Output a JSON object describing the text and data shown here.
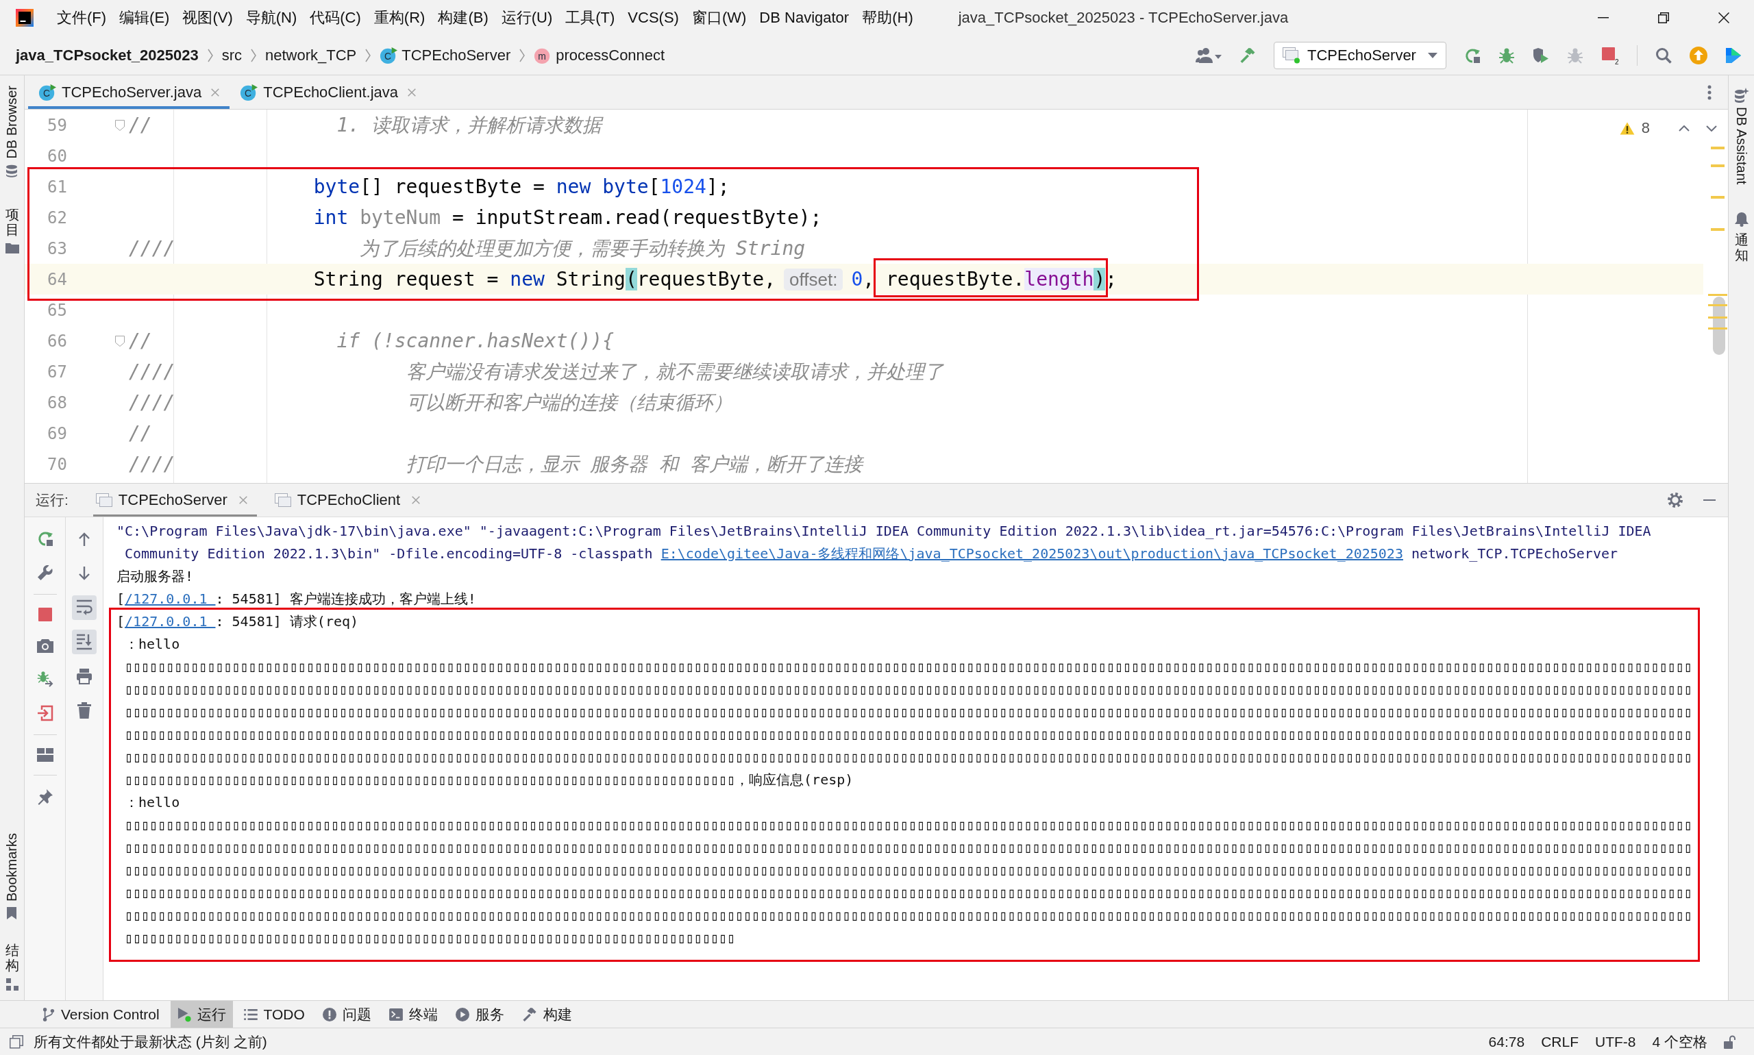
{
  "title_bar": {
    "menu": [
      "文件(F)",
      "编辑(E)",
      "视图(V)",
      "导航(N)",
      "代码(C)",
      "重构(R)",
      "构建(B)",
      "运行(U)",
      "工具(T)",
      "VCS(S)",
      "窗口(W)",
      "DB Navigator",
      "帮助(H)"
    ],
    "title": "java_TCPsocket_2025023 - TCPEchoServer.java"
  },
  "nav_bar": {
    "breadcrumbs": [
      {
        "label": "java_TCPsocket_2025023",
        "kind": "project"
      },
      {
        "label": "src",
        "kind": "folder"
      },
      {
        "label": "network_TCP",
        "kind": "package"
      },
      {
        "label": "TCPEchoServer",
        "kind": "class",
        "badge": "C"
      },
      {
        "label": "processConnect",
        "kind": "method",
        "badge": "m"
      }
    ],
    "run_config": "TCPEchoServer",
    "stop_count": "2"
  },
  "left_strip": {
    "top": [
      {
        "label": "DB Browser",
        "kind": "database"
      },
      {
        "label": "项目",
        "kind": "folder"
      }
    ],
    "bottom": [
      {
        "label": "Bookmarks",
        "kind": "bookmark"
      },
      {
        "label": "结构",
        "kind": "structure"
      }
    ]
  },
  "right_strip": [
    {
      "label": "DB Assistant",
      "kind": "assistant"
    },
    {
      "label": "通知",
      "kind": "bell"
    }
  ],
  "editor_tabs": [
    {
      "label": "TCPEchoServer.java",
      "badge": "C",
      "selected": true
    },
    {
      "label": "TCPEchoClient.java",
      "badge": "C",
      "selected": false
    }
  ],
  "editor": {
    "warning_count": "8",
    "lines": [
      {
        "number": "59",
        "current": false,
        "fold": true,
        "tokens": [
          {
            "text": "//                1. 读取请求，并解析请求数据",
            "kind": "comment"
          }
        ]
      },
      {
        "number": "60",
        "current": false,
        "fold": false
      },
      {
        "number": "61",
        "current": false,
        "fold": false,
        "tokens": [
          {
            "text": "                byte",
            "kind": "keyword"
          },
          {
            "text": "[] requestByte = ",
            "kind": "plain"
          },
          {
            "text": "new byte",
            "kind": "keyword"
          },
          {
            "text": "[",
            "kind": "plain"
          },
          {
            "text": "1024",
            "kind": "number"
          },
          {
            "text": "];",
            "kind": "plain"
          }
        ]
      },
      {
        "number": "62",
        "current": false,
        "fold": false,
        "tokens": [
          {
            "text": "                int",
            "kind": "keyword"
          },
          {
            "text": " byteNum",
            "kind": "unused"
          },
          {
            "text": " = inputStream.read(requestByte);",
            "kind": "plain"
          }
        ]
      },
      {
        "number": "63",
        "current": false,
        "fold": false,
        "tokens": [
          {
            "text": "////                为了后续的处理更加方便，需要手动转换为 String",
            "kind": "comment"
          }
        ]
      },
      {
        "number": "64",
        "current": true,
        "fold": false,
        "tokens": [
          {
            "text": "                String request = ",
            "kind": "plain"
          },
          {
            "text": "new",
            "kind": "keyword"
          },
          {
            "text": " String",
            "kind": "plain"
          },
          {
            "text": "(",
            "kind": "brace_match"
          },
          {
            "text": "requestByte,",
            "kind": "plain"
          },
          {
            "text": "offset:",
            "kind": "hint"
          },
          {
            "text": "0",
            "kind": "number"
          },
          {
            "text": ", requestByte.",
            "kind": "plain"
          },
          {
            "text": "length",
            "kind": "field_usage"
          },
          {
            "text": ")",
            "kind": "brace_match"
          },
          {
            "text": ";",
            "kind": "plain"
          }
        ]
      },
      {
        "number": "65",
        "current": false,
        "fold": false
      },
      {
        "number": "66",
        "current": false,
        "fold": true,
        "tokens": [
          {
            "text": "//                if (!scanner.hasNext()){",
            "kind": "comment"
          }
        ]
      },
      {
        "number": "67",
        "current": false,
        "fold": false,
        "tokens": [
          {
            "text": "////                    客户端没有请求发送过来了，就不需要继续读取请求，并处理了",
            "kind": "comment"
          }
        ]
      },
      {
        "number": "68",
        "current": false,
        "fold": false,
        "tokens": [
          {
            "text": "////                    可以断开和客户端的连接（结束循环）",
            "kind": "comment"
          }
        ]
      },
      {
        "number": "69",
        "current": false,
        "fold": false,
        "tokens": [
          {
            "text": "//",
            "kind": "comment"
          }
        ]
      },
      {
        "number": "70",
        "current": false,
        "fold": false,
        "tokens": [
          {
            "text": "////                    打印一个日志，显示 服务器 和 客户端，断开了连接",
            "kind": "comment"
          }
        ]
      }
    ]
  },
  "run_panel": {
    "label": "运行:",
    "tabs": [
      {
        "label": "TCPEchoServer",
        "selected": true
      },
      {
        "label": "TCPEchoClient",
        "selected": false
      }
    ],
    "left_tools": [
      [
        {
          "kind": "rerun"
        },
        {
          "kind": "wrench"
        }
      ],
      [
        {
          "kind": "stop"
        },
        {
          "kind": "camera"
        },
        {
          "kind": "debug"
        },
        {
          "kind": "exit"
        }
      ],
      [
        {
          "kind": "layout"
        }
      ],
      [
        {
          "kind": "pin"
        }
      ]
    ],
    "right_tools": [
      {
        "kind": "up",
        "on": false
      },
      {
        "kind": "down",
        "on": false
      },
      {
        "kind": "soft_wrap",
        "on": true
      },
      {
        "kind": "scroll_end",
        "on": true
      },
      {
        "kind": "print",
        "on": false
      },
      {
        "kind": "trash",
        "on": false
      }
    ],
    "console": [
      {
        "lines": [
          [
            {
              "text": "\"C:\\Program Files\\Java\\jdk-17\\bin\\java.exe\" \"-javaagent:C:\\Program Files\\JetBrains\\IntelliJ IDEA Community Edition 2022.1.3\\lib\\idea_rt.jar=54576:C:\\Program Files\\JetBrains\\IntelliJ IDEA",
              "kind": "system"
            }
          ],
          [
            {
              "text": "Community Edition 2022.1.3\\bin\" -Dfile.encoding=UTF-8 -classpath ",
              "kind": "system"
            },
            {
              "text": "E:\\code\\gitee\\Java-多线程和网络\\java_TCPsocket_2025023\\out\\production\\java_TCPsocket_2025023",
              "kind": "link"
            },
            {
              "text": " network_TCP.TCPEchoServer",
              "kind": "system"
            }
          ]
        ]
      },
      {
        "lines": [
          [
            {
              "text": "启动服务器!",
              "kind": "output"
            }
          ]
        ]
      },
      {
        "lines": [
          [
            {
              "text": "[",
              "kind": "output"
            },
            {
              "text": "/127.0.0.1 ",
              "kind": "link"
            },
            {
              "text": ": 54581] 客户端连接成功，客户端上线!",
              "kind": "output"
            }
          ]
        ]
      },
      {
        "lines": [
          [
            {
              "text": "[",
              "kind": "output"
            },
            {
              "text": "/127.0.0.1 ",
              "kind": "link"
            },
            {
              "text": ": 54581] 请求(req)",
              "kind": "output"
            }
          ],
          [
            {
              "text": "：hello",
              "kind": "output"
            }
          ],
          [
            {
              "text": "▯▯▯▯▯▯▯▯▯▯▯▯▯▯▯▯▯▯▯▯▯▯▯▯▯▯▯▯▯▯▯▯▯▯▯▯▯▯▯▯▯▯▯▯▯▯▯▯▯▯▯▯▯▯▯▯▯▯▯▯▯▯▯▯",
              "kind": "output"
            },
            {
              "text": "▯▯▯▯▯▯▯▯▯▯▯▯▯▯▯▯▯▯▯▯▯▯▯▯▯▯▯▯▯▯▯▯▯▯▯▯▯▯▯▯▯▯▯▯▯▯▯▯▯▯▯▯▯▯▯▯▯▯▯▯▯▯▯▯",
              "kind": "output"
            },
            {
              "text": "▯▯▯▯▯▯▯▯▯▯▯▯▯▯▯▯▯▯▯▯▯▯▯▯▯▯▯▯▯▯▯▯▯▯▯▯▯▯▯▯▯▯▯▯▯▯▯▯▯▯▯▯▯▯▯▯▯▯▯▯▯▯▯▯",
              "kind": "output"
            },
            {
              "text": "▯▯▯▯▯▯▯▯▯▯▯▯▯▯▯▯▯▯▯▯▯▯▯▯▯▯▯▯▯▯▯▯▯▯▯▯▯▯▯▯▯▯▯▯▯▯▯▯▯▯▯▯▯▯▯▯▯▯▯▯▯▯▯▯",
              "kind": "output"
            },
            {
              "text": "▯▯▯▯▯▯▯▯▯▯▯▯▯▯▯▯▯▯▯▯▯▯▯▯▯▯▯▯▯▯▯▯▯▯▯▯▯▯▯▯▯▯▯▯▯▯▯▯▯▯▯▯▯▯▯▯▯▯▯▯▯▯▯▯",
              "kind": "output"
            },
            {
              "text": "▯▯▯▯▯▯▯▯▯▯▯▯▯▯▯▯▯▯▯▯▯▯▯▯▯▯▯▯▯▯▯▯▯▯▯▯▯▯▯▯▯▯▯▯▯▯▯▯▯▯▯▯▯▯▯▯▯▯▯▯▯▯▯▯",
              "kind": "output"
            },
            {
              "text": "▯▯▯▯▯▯▯▯▯▯▯▯▯▯▯▯▯▯▯▯▯▯▯▯▯▯▯▯▯▯▯▯▯▯▯▯▯▯▯▯▯▯▯▯▯▯▯▯▯▯▯▯▯▯▯▯▯▯▯▯▯▯▯▯",
              "kind": "output"
            },
            {
              "text": "▯▯▯▯▯▯▯▯▯▯▯▯▯▯▯▯▯▯▯▯▯▯▯▯▯▯▯▯▯▯▯▯▯▯▯▯▯▯▯▯▯▯▯▯▯▯▯▯▯▯▯▯▯▯▯▯▯▯▯▯▯▯▯▯",
              "kind": "output"
            },
            {
              "text": "▯▯▯▯▯▯▯▯▯▯▯▯▯▯▯▯▯▯▯▯▯▯▯▯▯▯▯▯▯▯▯▯▯▯▯▯▯▯▯▯▯▯▯▯▯▯▯▯▯▯▯▯▯▯▯▯▯▯▯▯▯▯▯▯",
              "kind": "output"
            },
            {
              "text": "▯▯▯▯▯▯▯▯▯▯▯▯▯▯▯▯▯▯▯▯▯▯▯▯▯▯▯▯▯▯▯▯▯▯▯▯▯▯▯▯▯▯▯▯▯▯▯▯▯▯▯▯▯▯▯▯▯▯▯▯▯▯▯▯",
              "kind": "output"
            },
            {
              "text": "▯▯▯▯▯▯▯▯▯▯▯▯▯▯▯▯▯▯▯▯▯▯▯▯▯▯▯▯▯▯▯▯▯▯▯▯▯▯▯▯▯▯▯▯▯▯▯▯▯▯▯▯▯▯▯▯▯▯▯▯▯▯▯▯",
              "kind": "output"
            },
            {
              "text": "▯▯▯▯▯▯▯▯▯▯▯▯▯▯▯▯▯▯▯▯▯▯▯▯▯▯▯▯▯▯▯▯▯▯▯▯▯▯▯▯▯▯▯▯▯▯▯▯▯▯▯▯▯▯▯▯▯▯▯▯▯▯▯▯",
              "kind": "output"
            },
            {
              "text": "▯▯▯▯▯▯▯▯▯▯▯▯▯▯▯▯▯▯▯▯▯▯▯▯▯▯▯▯▯▯▯▯▯▯▯▯▯▯▯▯▯▯▯▯▯▯▯▯▯▯▯▯▯▯▯▯▯▯▯▯▯▯▯▯",
              "kind": "output"
            },
            {
              "text": "▯▯▯▯▯▯▯▯▯▯▯▯▯▯▯▯▯▯▯▯▯▯▯▯▯▯▯▯▯▯▯▯▯▯▯▯▯▯▯▯▯▯▯▯▯▯▯▯▯▯▯▯▯▯▯▯▯▯▯▯▯▯▯▯",
              "kind": "output"
            },
            {
              "text": "▯▯▯▯▯▯▯▯▯▯▯▯▯▯▯▯▯▯▯▯▯▯▯▯▯▯▯▯▯▯▯▯▯▯▯▯▯▯▯▯▯▯▯▯▯▯▯▯▯▯▯▯▯▯▯▯▯▯▯▯▯▯▯▯",
              "kind": "output"
            },
            {
              "text": "▯▯▯▯▯▯▯▯▯▯▯▯▯▯▯▯▯▯▯▯▯▯▯▯▯▯▯▯▯▯▯▯▯▯▯▯▯▯▯▯▯▯▯▯▯▯▯▯▯▯▯▯▯▯▯▯▯▯▯▯▯▯▯▯，响应信息(resp)",
              "kind": "output"
            }
          ],
          [
            {
              "text": "：hello",
              "kind": "output"
            }
          ],
          [
            {
              "text": "▯▯▯▯▯▯▯▯▯▯▯▯▯▯▯▯▯▯▯▯▯▯▯▯▯▯▯▯▯▯▯▯▯▯▯▯▯▯▯▯▯▯▯▯▯▯▯▯▯▯▯▯▯▯▯▯▯▯▯▯▯▯▯▯",
              "kind": "output"
            },
            {
              "text": "▯▯▯▯▯▯▯▯▯▯▯▯▯▯▯▯▯▯▯▯▯▯▯▯▯▯▯▯▯▯▯▯▯▯▯▯▯▯▯▯▯▯▯▯▯▯▯▯▯▯▯▯▯▯▯▯▯▯▯▯▯▯▯▯",
              "kind": "output"
            },
            {
              "text": "▯▯▯▯▯▯▯▯▯▯▯▯▯▯▯▯▯▯▯▯▯▯▯▯▯▯▯▯▯▯▯▯▯▯▯▯▯▯▯▯▯▯▯▯▯▯▯▯▯▯▯▯▯▯▯▯▯▯▯▯▯▯▯▯",
              "kind": "output"
            },
            {
              "text": "▯▯▯▯▯▯▯▯▯▯▯▯▯▯▯▯▯▯▯▯▯▯▯▯▯▯▯▯▯▯▯▯▯▯▯▯▯▯▯▯▯▯▯▯▯▯▯▯▯▯▯▯▯▯▯▯▯▯▯▯▯▯▯▯",
              "kind": "output"
            },
            {
              "text": "▯▯▯▯▯▯▯▯▯▯▯▯▯▯▯▯▯▯▯▯▯▯▯▯▯▯▯▯▯▯▯▯▯▯▯▯▯▯▯▯▯▯▯▯▯▯▯▯▯▯▯▯▯▯▯▯▯▯▯▯▯▯▯▯",
              "kind": "output"
            },
            {
              "text": "▯▯▯▯▯▯▯▯▯▯▯▯▯▯▯▯▯▯▯▯▯▯▯▯▯▯▯▯▯▯▯▯▯▯▯▯▯▯▯▯▯▯▯▯▯▯▯▯▯▯▯▯▯▯▯▯▯▯▯▯▯▯▯▯",
              "kind": "output"
            },
            {
              "text": "▯▯▯▯▯▯▯▯▯▯▯▯▯▯▯▯▯▯▯▯▯▯▯▯▯▯▯▯▯▯▯▯▯▯▯▯▯▯▯▯▯▯▯▯▯▯▯▯▯▯▯▯▯▯▯▯▯▯▯▯▯▯▯▯",
              "kind": "output"
            },
            {
              "text": "▯▯▯▯▯▯▯▯▯▯▯▯▯▯▯▯▯▯▯▯▯▯▯▯▯▯▯▯▯▯▯▯▯▯▯▯▯▯▯▯▯▯▯▯▯▯▯▯▯▯▯▯▯▯▯▯▯▯▯▯▯▯▯▯",
              "kind": "output"
            },
            {
              "text": "▯▯▯▯▯▯▯▯▯▯▯▯▯▯▯▯▯▯▯▯▯▯▯▯▯▯▯▯▯▯▯▯▯▯▯▯▯▯▯▯▯▯▯▯▯▯▯▯▯▯▯▯▯▯▯▯▯▯▯▯▯▯▯▯",
              "kind": "output"
            },
            {
              "text": "▯▯▯▯▯▯▯▯▯▯▯▯▯▯▯▯▯▯▯▯▯▯▯▯▯▯▯▯▯▯▯▯▯▯▯▯▯▯▯▯▯▯▯▯▯▯▯▯▯▯▯▯▯▯▯▯▯▯▯▯▯▯▯▯",
              "kind": "output"
            },
            {
              "text": "▯▯▯▯▯▯▯▯▯▯▯▯▯▯▯▯▯▯▯▯▯▯▯▯▯▯▯▯▯▯▯▯▯▯▯▯▯▯▯▯▯▯▯▯▯▯▯▯▯▯▯▯▯▯▯▯▯▯▯▯▯▯▯▯",
              "kind": "output"
            },
            {
              "text": "▯▯▯▯▯▯▯▯▯▯▯▯▯▯▯▯▯▯▯▯▯▯▯▯▯▯▯▯▯▯▯▯▯▯▯▯▯▯▯▯▯▯▯▯▯▯▯▯▯▯▯▯▯▯▯▯▯▯▯▯▯▯▯▯",
              "kind": "output"
            },
            {
              "text": "▯▯▯▯▯▯▯▯▯▯▯▯▯▯▯▯▯▯▯▯▯▯▯▯▯▯▯▯▯▯▯▯▯▯▯▯▯▯▯▯▯▯▯▯▯▯▯▯▯▯▯▯▯▯▯▯▯▯▯▯▯▯▯▯",
              "kind": "output"
            },
            {
              "text": "▯▯▯▯▯▯▯▯▯▯▯▯▯▯▯▯▯▯▯▯▯▯▯▯▯▯▯▯▯▯▯▯▯▯▯▯▯▯▯▯▯▯▯▯▯▯▯▯▯▯▯▯▯▯▯▯▯▯▯▯▯▯▯▯",
              "kind": "output"
            },
            {
              "text": "▯▯▯▯▯▯▯▯▯▯▯▯▯▯▯▯▯▯▯▯▯▯▯▯▯▯▯▯▯▯▯▯▯▯▯▯▯▯▯▯▯▯▯▯▯▯▯▯▯▯▯▯▯▯▯▯▯▯▯▯▯▯▯▯",
              "kind": "output"
            },
            {
              "text": "▯▯▯▯▯▯▯▯▯▯▯▯▯▯▯▯▯▯▯▯▯▯▯▯▯▯▯▯▯▯▯▯▯▯▯▯▯▯▯▯▯▯▯▯▯▯▯▯▯▯▯▯▯▯▯▯▯▯▯▯▯▯▯▯",
              "kind": "output"
            }
          ]
        ]
      }
    ]
  },
  "tool_window_bar": [
    {
      "label": "Version Control",
      "kind": "vcs",
      "selected": false
    },
    {
      "label": "运行",
      "kind": "run",
      "selected": true
    },
    {
      "label": "TODO",
      "kind": "todo",
      "selected": false
    },
    {
      "label": "问题",
      "kind": "problems",
      "selected": false
    },
    {
      "label": "终端",
      "kind": "terminal",
      "selected": false
    },
    {
      "label": "服务",
      "kind": "services",
      "selected": false
    },
    {
      "label": "构建",
      "kind": "build",
      "selected": false
    }
  ],
  "status_bar": {
    "message": "所有文件都处于最新状态 (片刻 之前)",
    "items": [
      "64:78",
      "CRLF",
      "UTF-8",
      "4 个空格"
    ]
  }
}
